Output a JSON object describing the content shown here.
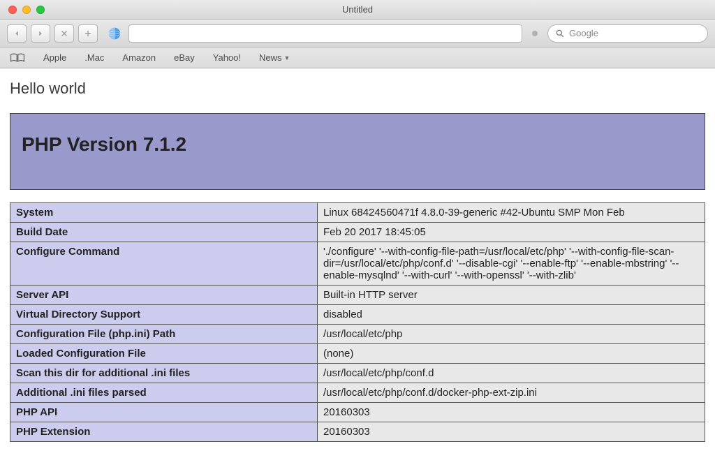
{
  "window": {
    "title": "Untitled"
  },
  "toolbar": {
    "address_value": "",
    "search_placeholder": "Google"
  },
  "bookmarks": [
    "Apple",
    ".Mac",
    "Amazon",
    "eBay",
    "Yahoo!",
    "News"
  ],
  "page": {
    "hello": "Hello world",
    "php_version_label": "PHP Version 7.1.2",
    "rows": [
      {
        "k": "System",
        "v": "Linux 68424560471f 4.8.0-39-generic #42-Ubuntu SMP Mon Feb"
      },
      {
        "k": "Build Date",
        "v": "Feb 20 2017 18:45:05"
      },
      {
        "k": "Configure Command",
        "v": "'./configure' '--with-config-file-path=/usr/local/etc/php' '--with-config-file-scan-dir=/usr/local/etc/php/conf.d' '--disable-cgi' '--enable-ftp' '--enable-mbstring' '--enable-mysqlnd' '--with-curl' '--with-openssl' '--with-zlib'"
      },
      {
        "k": "Server API",
        "v": "Built-in HTTP server"
      },
      {
        "k": "Virtual Directory Support",
        "v": "disabled"
      },
      {
        "k": "Configuration File (php.ini) Path",
        "v": "/usr/local/etc/php"
      },
      {
        "k": "Loaded Configuration File",
        "v": "(none)"
      },
      {
        "k": "Scan this dir for additional .ini files",
        "v": "/usr/local/etc/php/conf.d"
      },
      {
        "k": "Additional .ini files parsed",
        "v": "/usr/local/etc/php/conf.d/docker-php-ext-zip.ini"
      },
      {
        "k": "PHP API",
        "v": "20160303"
      },
      {
        "k": "PHP Extension",
        "v": "20160303"
      }
    ]
  }
}
